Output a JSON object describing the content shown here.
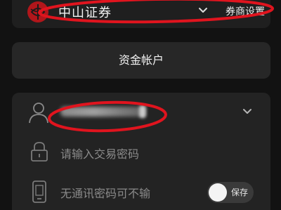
{
  "broker": {
    "name": "中山证券",
    "settings_label": "券商设置",
    "logo_color": "#b1161b"
  },
  "fund_account": {
    "label": "资金帐户"
  },
  "login": {
    "password_placeholder": "请输入交易密码",
    "comm_password_label": "无通讯密码可不输",
    "save_toggle_label": "保存",
    "save_toggle_on": false
  },
  "icons": {
    "broker_logo": "broker-logo-icon",
    "broker_dropdown": "chevron-down-icon",
    "account": "user-icon",
    "account_dropdown": "chevron-down-icon",
    "password": "lock-icon",
    "comm_password": "phone-icon"
  },
  "colors": {
    "background": "#121212",
    "card": "#232323",
    "annotation": "#e0141e"
  }
}
